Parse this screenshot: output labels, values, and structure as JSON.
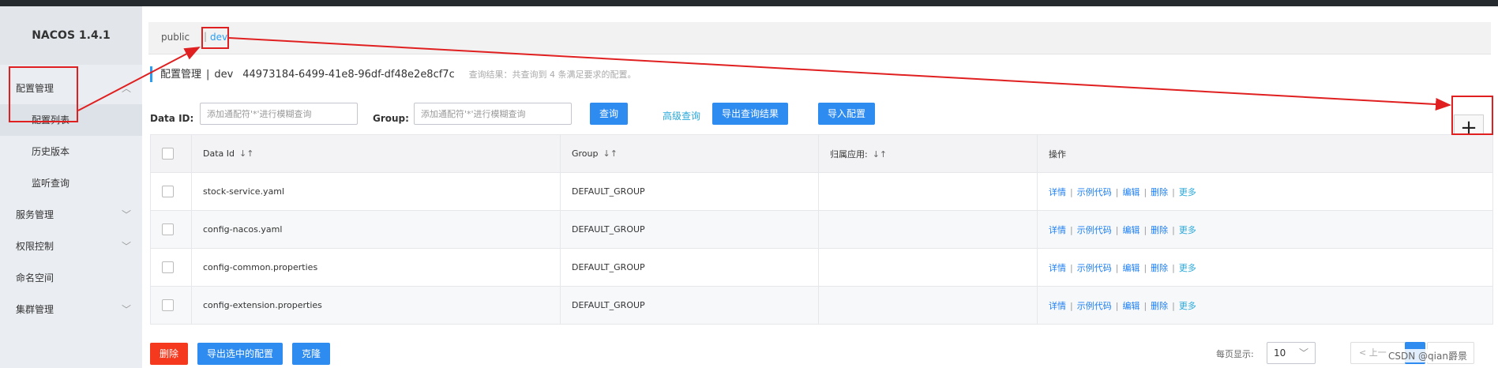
{
  "app": {
    "brand": "NACOS 1.4.1"
  },
  "sidebar": {
    "groups": [
      {
        "label": "配置管理",
        "expanded": true,
        "items": [
          "配置列表",
          "历史版本",
          "监听查询"
        ]
      },
      {
        "label": "服务管理"
      },
      {
        "label": "权限控制"
      },
      {
        "label": "命名空间"
      },
      {
        "label": "集群管理"
      }
    ]
  },
  "namespaces": {
    "items": [
      "public",
      "dev"
    ],
    "active": "dev",
    "separator": "|"
  },
  "title": {
    "main": "配置管理",
    "separator": "|",
    "namespace": "dev",
    "namespace_id": "44973184-6499-41e8-96df-df48e2e8cf7c",
    "result": "查询结果：共查询到 4 条满足要求的配置。"
  },
  "filters": {
    "data_id_label": "Data ID:",
    "data_id_placeholder": "添加通配符'*'进行模糊查询",
    "group_label": "Group:",
    "group_placeholder": "添加通配符'*'进行模糊查询",
    "query_button": "查询",
    "advanced_query": "高级查询",
    "export_results": "导出查询结果",
    "import_config": "导入配置",
    "add_icon": "plus-icon"
  },
  "table": {
    "columns": [
      "Data Id",
      "Group",
      "归属应用:",
      "操作"
    ],
    "sort_icon": "sort-icon",
    "rows": [
      {
        "data_id": "stock-service.yaml",
        "group": "DEFAULT_GROUP",
        "app": ""
      },
      {
        "data_id": "config-nacos.yaml",
        "group": "DEFAULT_GROUP",
        "app": ""
      },
      {
        "data_id": "config-common.properties",
        "group": "DEFAULT_GROUP",
        "app": ""
      },
      {
        "data_id": "config-extension.properties",
        "group": "DEFAULT_GROUP",
        "app": ""
      }
    ],
    "actions": [
      "详情",
      "示例代码",
      "编辑",
      "删除",
      "更多"
    ],
    "action_separator": "|"
  },
  "footer": {
    "delete": "删除",
    "export_selected": "导出选中的配置",
    "clone": "克隆",
    "page_size_label": "每页显示:",
    "page_size": "10",
    "prev": "< 上一",
    "watermark": "CSDN @qian爵景"
  },
  "colors": {
    "primary": "#2e8bf0",
    "link": "#1d7ff5",
    "link_light": "#2aa8d8",
    "danger": "#f5391e",
    "annotation": "#e02020",
    "sidebar_bg": "#eaedf1",
    "topbar": "#252a2f"
  }
}
